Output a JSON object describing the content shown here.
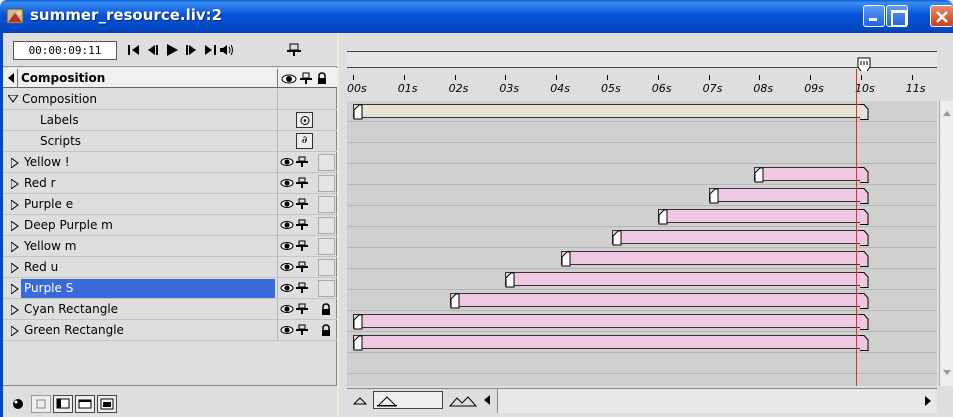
{
  "window": {
    "title": "summer_resource.liv:2",
    "title_icon": "liveMotion-file-icon",
    "buttons": [
      "minimize",
      "maximize",
      "close"
    ]
  },
  "toolbar": {
    "timecode": "00:00:09:11",
    "transport_icons": [
      "go-to-start-icon",
      "step-back-icon",
      "play-icon",
      "step-forward-icon",
      "go-to-end-icon",
      "audio-icon"
    ],
    "pin_icon": "pin-icon"
  },
  "column_header": {
    "label": "Composition",
    "icons": [
      "eye-icon",
      "pin-icon",
      "lock-icon"
    ]
  },
  "layers": [
    {
      "name": "Composition",
      "type": "composition",
      "expanded": true
    },
    {
      "name": "Labels",
      "type": "labels"
    },
    {
      "name": "Scripts",
      "type": "scripts"
    },
    {
      "name": "Yellow !",
      "type": "layer"
    },
    {
      "name": "Red r",
      "type": "layer"
    },
    {
      "name": "Purple e",
      "type": "layer"
    },
    {
      "name": "Deep Purple m",
      "type": "layer"
    },
    {
      "name": "Yellow m",
      "type": "layer"
    },
    {
      "name": "Red u",
      "type": "layer"
    },
    {
      "name": "Purple S",
      "type": "layer",
      "selected": true
    },
    {
      "name": "Cyan Rectangle",
      "type": "layer",
      "locked": true
    },
    {
      "name": "Green Rectangle",
      "type": "layer",
      "locked": true
    }
  ],
  "ruler": {
    "ticks": [
      "00s",
      "01s",
      "02s",
      "03s",
      "04s",
      "05s",
      "06s",
      "07s",
      "08s",
      "09s",
      "10s",
      "11s"
    ]
  },
  "timeline": {
    "current_time_seconds": 9.9,
    "bars": [
      {
        "row": 0,
        "start_s": 0.0,
        "end_s": 10.0,
        "kind": "comp"
      },
      {
        "row": 3,
        "start_s": 7.9,
        "end_s": 10.0,
        "kind": "layer"
      },
      {
        "row": 4,
        "start_s": 7.0,
        "end_s": 10.0,
        "kind": "layer"
      },
      {
        "row": 5,
        "start_s": 6.0,
        "end_s": 10.0,
        "kind": "layer"
      },
      {
        "row": 6,
        "start_s": 5.1,
        "end_s": 10.0,
        "kind": "layer"
      },
      {
        "row": 7,
        "start_s": 4.1,
        "end_s": 10.0,
        "kind": "layer"
      },
      {
        "row": 8,
        "start_s": 3.0,
        "end_s": 10.0,
        "kind": "layer"
      },
      {
        "row": 9,
        "start_s": 1.9,
        "end_s": 10.0,
        "kind": "layer"
      },
      {
        "row": 10,
        "start_s": 0.0,
        "end_s": 10.0,
        "kind": "layer"
      },
      {
        "row": 11,
        "start_s": 0.0,
        "end_s": 10.0,
        "kind": "layer"
      }
    ]
  },
  "colors": {
    "title_bar": "#0754d8",
    "selection": "#3a6ad9",
    "layer_bar": "#f0c8e4",
    "playhead": "#e03020"
  }
}
